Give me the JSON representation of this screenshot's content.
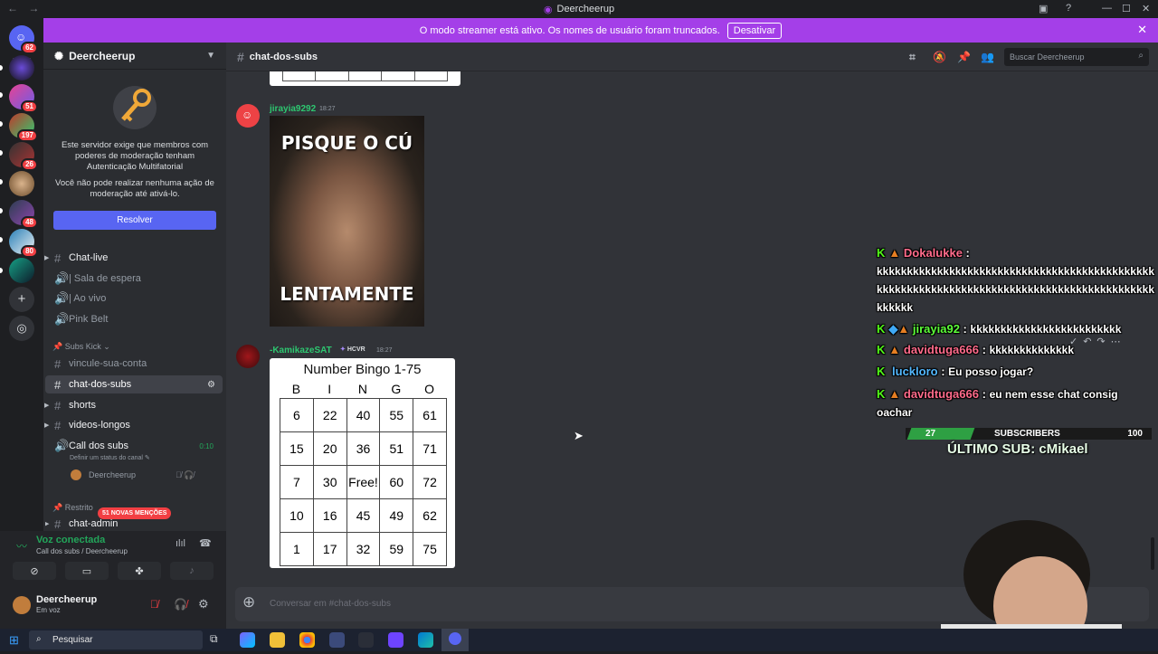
{
  "titlebar": {
    "title": "Deercheerup",
    "nav": "← →"
  },
  "servers": {
    "badges": [
      "62",
      "51",
      "197",
      "26",
      "48",
      "80"
    ],
    "add_label": "+"
  },
  "banner": {
    "text": "O modo streamer está ativo. Os nomes de usuário foram truncados.",
    "button": "Desativar",
    "close": "✕"
  },
  "sidebar": {
    "guild_name": "Deercheerup",
    "mfa_text": "Este servidor exige que membros com poderes de moderação tenham Autenticação Multifatorial",
    "mfa_text2": "Você não pode realizar nenhuma ação de moderação até ativá-lo.",
    "resolve_button": "Resolver",
    "channels": {
      "chat_live": "Chat-live",
      "sala": "| Sala de espera",
      "ao_vivo": "| Ao vivo",
      "pink_belt": "Pink Belt",
      "cat_subs_kick": "Subs Kick",
      "vincule": "vincule-sua-conta",
      "chat_dos_subs": "chat-dos-subs",
      "shorts": "shorts",
      "videos_longos": "videos-longos",
      "call_dos_subs": "Call dos subs",
      "call_time": "0:10",
      "call_status": "Definir um status do canal",
      "call_member": "Deercheerup",
      "cat_restrito": "Restrito",
      "mentions_pill": "51 NOVAS MENÇÕES",
      "chat_admin": "chat-admin"
    }
  },
  "voice": {
    "title": "Voz conectada",
    "sub": "Call dos subs / Deercheerup"
  },
  "user": {
    "name": "Deercheerup",
    "status": "Em voz"
  },
  "chat_header": {
    "channel": "chat-dos-subs",
    "search_placeholder": "Buscar Deercheerup"
  },
  "messages": {
    "m1_user": "jirayia9292",
    "m1_time": "18:27",
    "meme_top": "PISQUE O CÚ",
    "meme_bottom": "LENTAMENTE",
    "m2_user": "-KamikazeSAT",
    "m2_tag": "HCVR",
    "m2_time": "18:27"
  },
  "bingo": {
    "title": "Number Bingo 1-75",
    "headers": [
      "B",
      "I",
      "N",
      "G",
      "O"
    ],
    "rows": [
      [
        "6",
        "22",
        "40",
        "55",
        "61"
      ],
      [
        "15",
        "20",
        "36",
        "51",
        "71"
      ],
      [
        "7",
        "30",
        "Free!",
        "60",
        "72"
      ],
      [
        "10",
        "16",
        "45",
        "49",
        "62"
      ],
      [
        "1",
        "17",
        "32",
        "59",
        "75"
      ]
    ]
  },
  "composer": {
    "placeholder": "Conversar em #chat-dos-subs"
  },
  "overlay": {
    "msgs": [
      {
        "user": "Dokalukke",
        "sep": " :",
        "text": "kkkkkkkkkkkkkkkkkkkkkkkkkkkkkkkkkkkkkkkkkkkkkkkkkkkkkkkkkkkkkkkkkkkkkkkkkkkkkkkkkkkkkkkkkkkkkkkkkk",
        "color": "#ff6b8b"
      },
      {
        "user": "jirayia92",
        "sep": " :",
        "text": "kkkkkkkkkkkkkkkkkkkkkkkkk",
        "color": "#5dff3a"
      },
      {
        "user": "davidtuga666",
        "sep": " :",
        "text": "kkkkkkkkkkkkkk",
        "color": "#ff6b8b"
      },
      {
        "user": "luckloro",
        "sep": " :",
        "text": "Eu posso jogar?",
        "color": "#53b8ff"
      },
      {
        "user": "davidtuga666",
        "sep": " :",
        "text": "eu nem esse chat consig oachar",
        "color": "#ff6b8b"
      }
    ],
    "sub_left": "27",
    "sub_label": "SUBSCRIBERS",
    "sub_right": "100",
    "ultimo": "ÚLTIMO SUB: cMikael"
  },
  "taskbar": {
    "search": "Pesquisar"
  },
  "colors": {
    "accent": "#5865f2",
    "banner": "#a43fe8",
    "online": "#23a55a",
    "kick": "#53fc18"
  }
}
